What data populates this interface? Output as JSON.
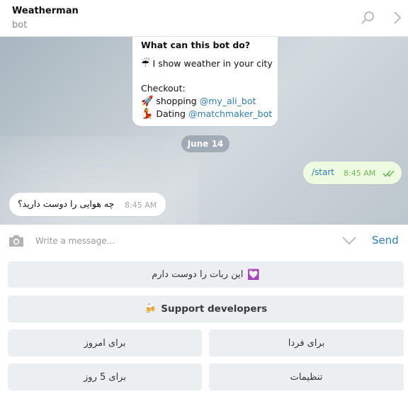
{
  "header": {
    "title": "Weatherman",
    "subtitle": "bot",
    "icons": [
      "search-icon",
      "chevron-right-icon"
    ]
  },
  "intro_card": {
    "heading": "What can this bot do?",
    "line1_emoji": "☔",
    "line1_text": "I show weather in your city",
    "checkout_label": "Checkout:",
    "item1_emoji": "🚀",
    "item1_text": "shopping",
    "item1_link": "@my_ali_bot",
    "item2_emoji": "💃",
    "item2_text": "Dating",
    "item2_link": "@matchmaker_bot"
  },
  "date_divider": "June 14",
  "messages": [
    {
      "direction": "out",
      "text": "/start",
      "time": "8:45 AM",
      "status": "read"
    },
    {
      "direction": "in",
      "text": "چه هوایی را دوست دارید؟",
      "time": "8:45 AM"
    }
  ],
  "composer": {
    "placeholder": "Write a message...",
    "send_label": "Send"
  },
  "keyboard": {
    "row1": {
      "label": "این ربات را دوست دارم",
      "emoji": "💟"
    },
    "row2": {
      "label": "Support developers",
      "emoji": "🍻"
    },
    "row3": [
      "برای امروز",
      "برای فردا"
    ],
    "row4": [
      "برای 5 روز",
      "تنظیمات"
    ]
  },
  "colors": {
    "accent": "#2f7fb5",
    "outgoing_bubble": "#eefbe0",
    "read_check": "#6fb85e",
    "keyboard_button": "#eceff1"
  }
}
